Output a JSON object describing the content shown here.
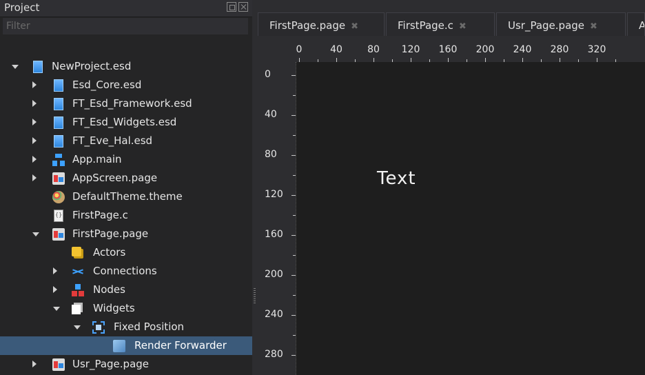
{
  "panel": {
    "title": "Project",
    "filter_placeholder": "Filter"
  },
  "tree": [
    {
      "label": "NewProject.esd",
      "icon": "document-icon",
      "state": "expanded",
      "depth": 0
    },
    {
      "label": "Esd_Core.esd",
      "icon": "document-icon",
      "state": "collapsed",
      "depth": 1
    },
    {
      "label": "FT_Esd_Framework.esd",
      "icon": "document-icon",
      "state": "collapsed",
      "depth": 1
    },
    {
      "label": "FT_Esd_Widgets.esd",
      "icon": "document-icon",
      "state": "collapsed",
      "depth": 1
    },
    {
      "label": "FT_Eve_Hal.esd",
      "icon": "document-icon",
      "state": "collapsed",
      "depth": 1
    },
    {
      "label": "App.main",
      "icon": "app-hierarchy-icon",
      "state": "collapsed",
      "depth": 1
    },
    {
      "label": "AppScreen.page",
      "icon": "page-icon",
      "state": "collapsed",
      "depth": 1
    },
    {
      "label": "DefaultTheme.theme",
      "icon": "palette-icon",
      "state": "leaf",
      "depth": 1
    },
    {
      "label": "FirstPage.c",
      "icon": "c-source-icon",
      "state": "leaf",
      "depth": 1
    },
    {
      "label": "FirstPage.page",
      "icon": "page-icon",
      "state": "expanded",
      "depth": 1
    },
    {
      "label": "Actors",
      "icon": "actors-icon",
      "state": "leaf",
      "depth": 2
    },
    {
      "label": "Connections",
      "icon": "connections-icon",
      "state": "collapsed",
      "depth": 2
    },
    {
      "label": "Nodes",
      "icon": "nodes-icon",
      "state": "collapsed",
      "depth": 2
    },
    {
      "label": "Widgets",
      "icon": "widgets-icon",
      "state": "expanded",
      "depth": 2
    },
    {
      "label": "Fixed Position",
      "icon": "fixed-position-icon",
      "state": "expanded",
      "depth": 3
    },
    {
      "label": "Render Forwarder",
      "icon": "render-forwarder-icon",
      "state": "leaf",
      "depth": 4,
      "selected": true
    },
    {
      "label": "Usr_Page.page",
      "icon": "page-icon",
      "state": "collapsed",
      "depth": 1
    }
  ],
  "tabs": [
    {
      "label": "FirstPage.page",
      "close": "✖"
    },
    {
      "label": "FirstPage.c",
      "close": "✖"
    },
    {
      "label": "Usr_Page.page",
      "close": "✖"
    },
    {
      "label": "A",
      "close": ""
    }
  ],
  "ruler": {
    "horizontal": [
      "0",
      "40",
      "80",
      "120",
      "160",
      "200",
      "240",
      "280",
      "320"
    ],
    "vertical": [
      "0",
      "40",
      "80",
      "120",
      "160",
      "200",
      "240",
      "280"
    ]
  },
  "canvas": {
    "text_widget": "Text"
  },
  "colors": {
    "selection": "#3b5a7a",
    "canvas": "#1e1e1e",
    "panel": "#252526"
  }
}
